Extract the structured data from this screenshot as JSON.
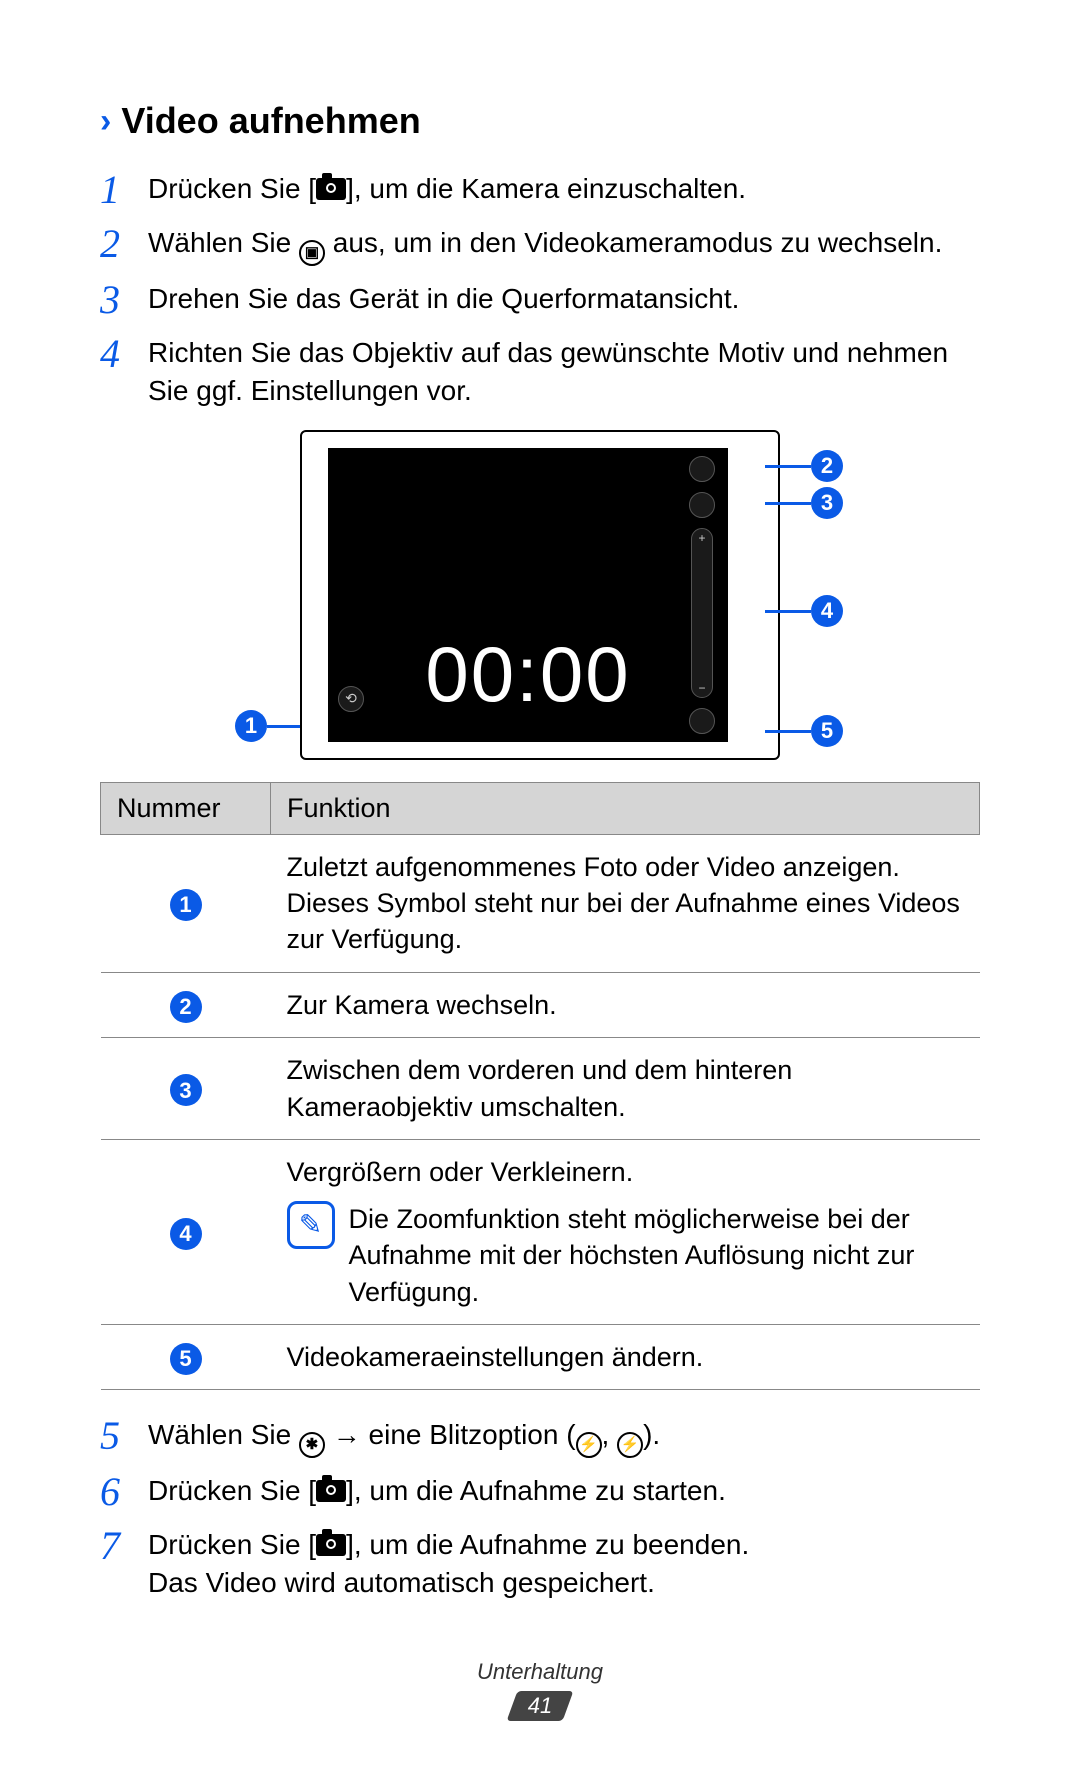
{
  "section": {
    "title": "Video aufnehmen"
  },
  "steps": {
    "s1": {
      "n": "1",
      "pre": "Drücken Sie [",
      "post": "], um die Kamera einzuschalten."
    },
    "s2": {
      "n": "2",
      "pre": "Wählen Sie ",
      "post": " aus, um in den Videokameramodus zu wechseln."
    },
    "s3": {
      "n": "3",
      "text": "Drehen Sie das Gerät in die Querformatansicht."
    },
    "s4": {
      "n": "4",
      "text": "Richten Sie das Objektiv auf das gewünschte Motiv und nehmen Sie ggf. Einstellungen vor."
    },
    "s5": {
      "n": "5",
      "pre": "Wählen Sie ",
      "mid": " → eine Blitzoption (",
      "sep": ", ",
      "post": ")."
    },
    "s6": {
      "n": "6",
      "pre": "Drücken Sie [",
      "post": "], um die Aufnahme zu starten."
    },
    "s7": {
      "n": "7",
      "pre": "Drücken Sie [",
      "post": "], um die Aufnahme zu beenden.",
      "extra": "Das Video wird automatisch gespeichert."
    }
  },
  "figure": {
    "timer": "00:00",
    "callouts": {
      "c1": "1",
      "c2": "2",
      "c3": "3",
      "c4": "4",
      "c5": "5"
    }
  },
  "table": {
    "h1": "Nummer",
    "h2": "Funktion",
    "r1": {
      "n": "1",
      "text": "Zuletzt aufgenommenes Foto oder Video anzeigen. Dieses Symbol steht nur bei der Aufnahme eines Videos zur Verfügung."
    },
    "r2": {
      "n": "2",
      "text": "Zur Kamera wechseln."
    },
    "r3": {
      "n": "3",
      "text": "Zwischen dem vorderen und dem hinteren Kameraobjektiv umschalten."
    },
    "r4": {
      "n": "4",
      "text": "Vergrößern oder Verkleinern.",
      "note": "Die Zoomfunktion steht möglicherweise bei der Aufnahme mit der höchsten Auflösung nicht zur Verfügung."
    },
    "r5": {
      "n": "5",
      "text": "Videokameraeinstellungen ändern."
    }
  },
  "footer": {
    "section": "Unterhaltung",
    "page": "41"
  }
}
